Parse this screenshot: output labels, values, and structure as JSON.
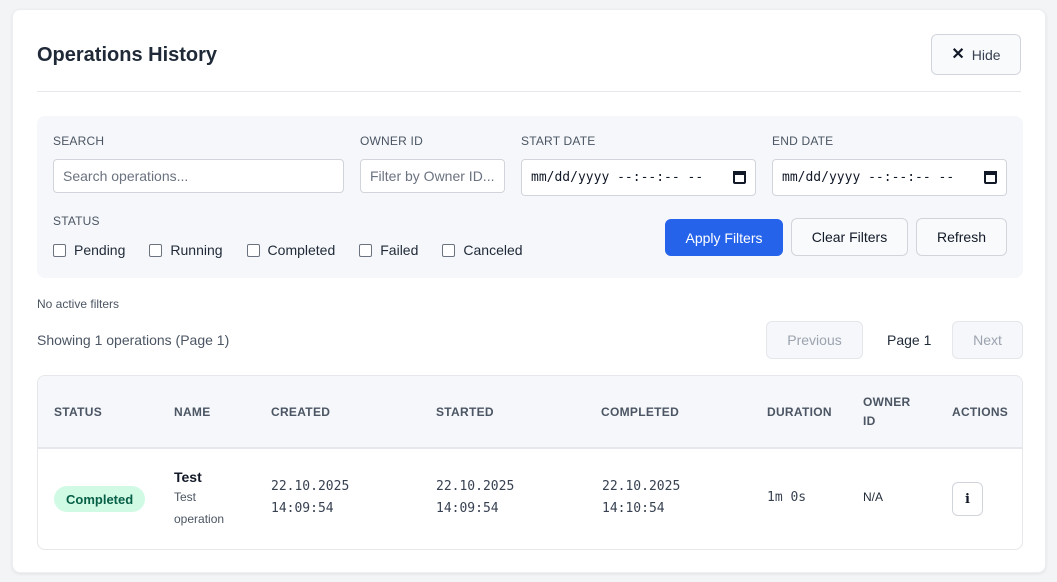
{
  "header": {
    "title": "Operations History",
    "hide_label": "Hide",
    "hide_icon": "close-icon"
  },
  "filters": {
    "search_label": "SEARCH",
    "search_placeholder": "Search operations...",
    "owner_label": "OWNER ID",
    "owner_placeholder": "Filter by Owner ID...",
    "start_label": "START DATE",
    "start_value": "mm/dd/yyyy --:--:-- --",
    "end_label": "END DATE",
    "end_value": "mm/dd/yyyy --:--:-- --",
    "status_label": "STATUS",
    "statuses": [
      "Pending",
      "Running",
      "Completed",
      "Failed",
      "Canceled"
    ],
    "apply_label": "Apply Filters",
    "clear_label": "Clear Filters",
    "refresh_label": "Refresh"
  },
  "info": {
    "no_filters": "No active filters",
    "showing": "Showing 1 operations (Page 1)"
  },
  "pagination": {
    "previous": "Previous",
    "page": "Page 1",
    "next": "Next"
  },
  "table": {
    "headers": {
      "status": "STATUS",
      "name": "NAME",
      "created": "CREATED",
      "started": "STARTED",
      "completed": "COMPLETED",
      "duration": "DURATION",
      "owner_id_1": "OWNER",
      "owner_id_2": "ID",
      "actions": "ACTIONS"
    },
    "rows": [
      {
        "status": "Completed",
        "name": "Test",
        "description_1": "Test",
        "description_2": "operation",
        "created_date": "22.10.2025",
        "created_time": "14:09:54",
        "started_date": "22.10.2025",
        "started_time": "14:09:54",
        "completed_date": "22.10.2025",
        "completed_time": "14:10:54",
        "duration": "1m 0s",
        "owner_id": "N/A",
        "action_icon": "info-icon",
        "action_glyph": "i"
      }
    ]
  },
  "colors": {
    "accent": "#2563eb",
    "badge_bg": "#d1fae5",
    "badge_text": "#065f46"
  }
}
